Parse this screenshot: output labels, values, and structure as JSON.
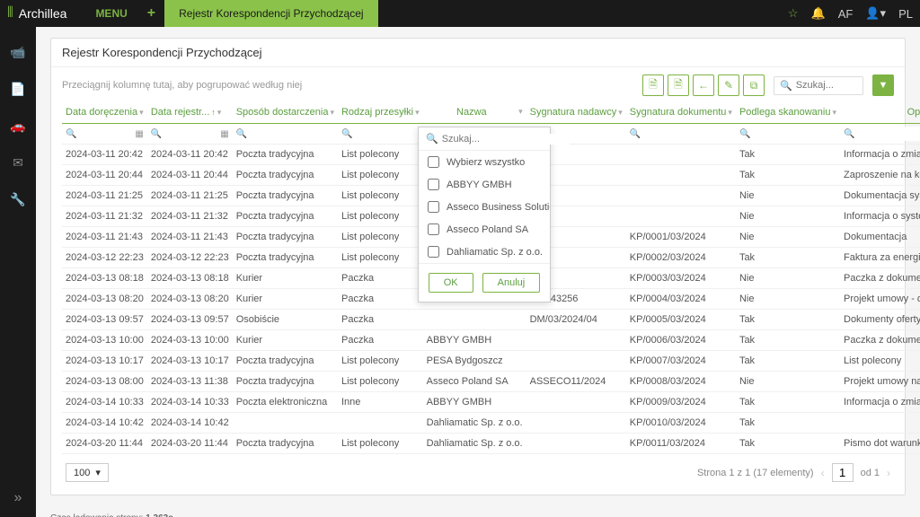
{
  "app": {
    "name": "Archillea",
    "menu": "MENU",
    "tab": "Rejestr Korespondencji Przychodzącej",
    "user": "AF",
    "lang": "PL"
  },
  "panel": {
    "title": "Rejestr Korespondencji Przychodzącej",
    "groupHint": "Przeciągnij kolumnę tutaj, aby pogrupować według niej",
    "searchPlaceholder": "Szukaj..."
  },
  "columns": {
    "deliveryDate": "Data doręczenia",
    "registerDate": "Data rejestr...",
    "method": "Sposób dostarczenia",
    "type": "Rodzaj przesyłki",
    "name": "Nazwa",
    "senderSig": "Sygnatura nadawcy",
    "docSig": "Sygnatura dokumentu",
    "scan": "Podlega skanowaniu",
    "desc": "Opis"
  },
  "dropdown": {
    "searchPlaceholder": "Szukaj...",
    "selectAll": "Wybierz wszystko",
    "options": [
      "ABBYY GMBH",
      "Asseco Business Solutions Sp ...",
      "Asseco Poland SA",
      "Dahliamatic Sp. z o.o."
    ],
    "ok": "OK",
    "cancel": "Anuluj"
  },
  "rows": [
    {
      "d1": "2024-03-11 20:42",
      "d2": "2024-03-11 20:42",
      "m": "Poczta tradycyjna",
      "t": "List polecony",
      "n": "",
      "s1": "",
      "s2": "",
      "sc": "Tak",
      "de": "Informacja o zmianie wysokości o"
    },
    {
      "d1": "2024-03-11 20:44",
      "d2": "2024-03-11 20:44",
      "m": "Poczta tradycyjna",
      "t": "List polecony",
      "n": "",
      "s1": "",
      "s2": "",
      "sc": "Tak",
      "de": "Zaproszenie na konferencję"
    },
    {
      "d1": "2024-03-11 21:25",
      "d2": "2024-03-11 21:25",
      "m": "Poczta tradycyjna",
      "t": "List polecony",
      "n": "",
      "s1": "",
      "s2": "",
      "sc": "Nie",
      "de": "Dokumentacja systemu"
    },
    {
      "d1": "2024-03-11 21:32",
      "d2": "2024-03-11 21:32",
      "m": "Poczta tradycyjna",
      "t": "List polecony",
      "n": "",
      "s1": "",
      "s2": "",
      "sc": "Nie",
      "de": "Informacja o systemie"
    },
    {
      "d1": "2024-03-11 21:43",
      "d2": "2024-03-11 21:43",
      "m": "Poczta tradycyjna",
      "t": "List polecony",
      "n": "",
      "s1": "",
      "s2": "KP/0001/03/2024",
      "sc": "Nie",
      "de": "Dokumentacja"
    },
    {
      "d1": "2024-03-12 22:23",
      "d2": "2024-03-12 22:23",
      "m": "Poczta tradycyjna",
      "t": "List polecony",
      "n": "",
      "s1": "",
      "s2": "KP/0002/03/2024",
      "sc": "Tak",
      "de": "Faktura za energię elektryczną"
    },
    {
      "d1": "2024-03-13 08:18",
      "d2": "2024-03-13 08:18",
      "m": "Kurier",
      "t": "Paczka",
      "n": "",
      "s1": "",
      "s2": "KP/0003/03/2024",
      "sc": "Nie",
      "de": "Paczka z dokumentami"
    },
    {
      "d1": "2024-03-13 08:20",
      "d2": "2024-03-13 08:20",
      "m": "Kurier",
      "t": "Paczka",
      "n": "",
      "s1": "NM343256",
      "s2": "KP/0004/03/2024",
      "sc": "Nie",
      "de": "Projekt umowy - dokumenty"
    },
    {
      "d1": "2024-03-13 09:57",
      "d2": "2024-03-13 09:57",
      "m": "Osobiście",
      "t": "Paczka",
      "n": "",
      "s1": "DM/03/2024/04",
      "s2": "KP/0005/03/2024",
      "sc": "Tak",
      "de": "Dokumenty oferty"
    },
    {
      "d1": "2024-03-13 10:00",
      "d2": "2024-03-13 10:00",
      "m": "Kurier",
      "t": "Paczka",
      "n": "ABBYY GMBH",
      "s1": "",
      "s2": "KP/0006/03/2024",
      "sc": "Tak",
      "de": "Paczka z dokumentacją"
    },
    {
      "d1": "2024-03-13 10:17",
      "d2": "2024-03-13 10:17",
      "m": "Poczta tradycyjna",
      "t": "List polecony",
      "n": "PESA Bydgoszcz",
      "s1": "",
      "s2": "KP/0007/03/2024",
      "sc": "Tak",
      "de": "List polecony"
    },
    {
      "d1": "2024-03-13 08:00",
      "d2": "2024-03-13 11:38",
      "m": "Poczta tradycyjna",
      "t": "List polecony",
      "n": "Asseco Poland SA",
      "s1": "ASSECO11/2024",
      "s2": "KP/0008/03/2024",
      "sc": "Nie",
      "de": "Projekt umowy na wdrożenie sys"
    },
    {
      "d1": "2024-03-14 10:33",
      "d2": "2024-03-14 10:33",
      "m": "Poczta elektroniczna",
      "t": "Inne",
      "n": "ABBYY GMBH",
      "s1": "",
      "s2": "KP/0009/03/2024",
      "sc": "Tak",
      "de": "Informacja o zmianie cen"
    },
    {
      "d1": "2024-03-14 10:42",
      "d2": "2024-03-14 10:42",
      "m": "",
      "t": "",
      "n": "Dahliamatic Sp. z o.o.",
      "s1": "",
      "s2": "KP/0010/03/2024",
      "sc": "Tak",
      "de": ""
    },
    {
      "d1": "2024-03-20 11:44",
      "d2": "2024-03-20 11:44",
      "m": "Poczta tradycyjna",
      "t": "List polecony",
      "n": "Dahliamatic Sp. z o.o.",
      "s1": "",
      "s2": "KP/0011/03/2024",
      "sc": "Tak",
      "de": "Pismo dot warunków najmu"
    }
  ],
  "pager": {
    "pageSize": "100",
    "info": "Strona 1 z 1 (17 elementy)",
    "current": "1",
    "of": "od 1"
  },
  "footer": {
    "label": "Czas ładowania strony: ",
    "time": "1.363s"
  }
}
